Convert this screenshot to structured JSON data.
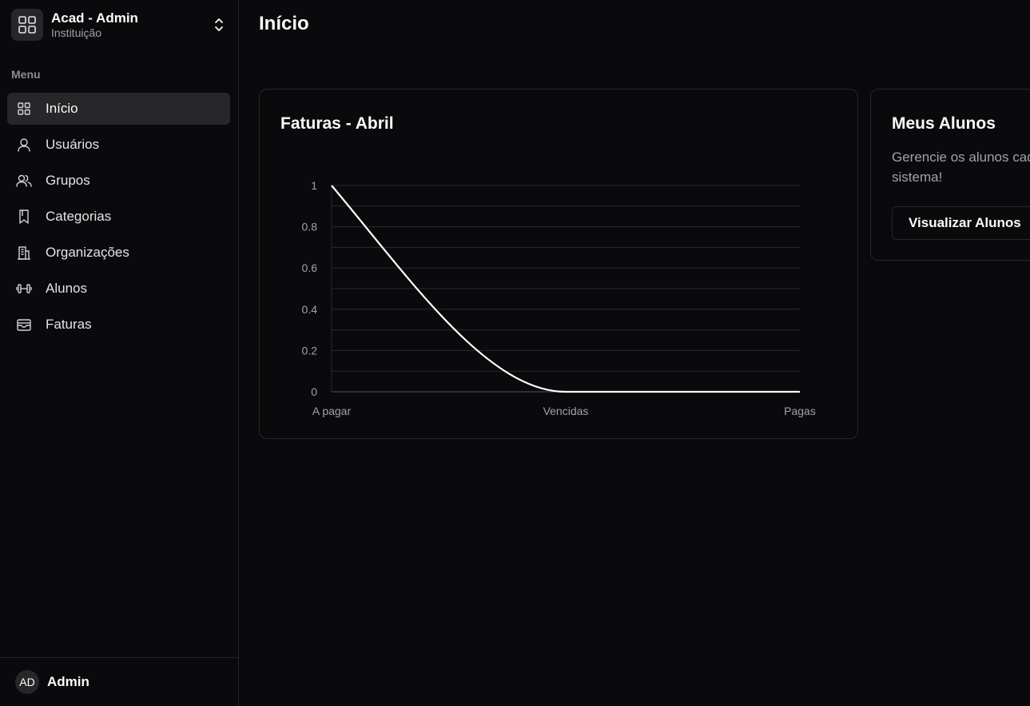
{
  "sidebar": {
    "team_name": "Acad - Admin",
    "team_subtitle": "Instituição",
    "menu_label": "Menu",
    "items": [
      {
        "label": "Início",
        "icon": "grid-icon",
        "active": true
      },
      {
        "label": "Usuários",
        "icon": "user-icon"
      },
      {
        "label": "Grupos",
        "icon": "users-icon"
      },
      {
        "label": "Categorias",
        "icon": "bookmark-icon"
      },
      {
        "label": "Organizações",
        "icon": "building-icon"
      },
      {
        "label": "Alunos",
        "icon": "dumbbell-icon"
      },
      {
        "label": "Faturas",
        "icon": "wallet-icon"
      }
    ],
    "user": {
      "initials": "AD",
      "name": "Admin"
    }
  },
  "header": {
    "title": "Início"
  },
  "chart_card": {
    "title": "Faturas - Abril"
  },
  "alunos_card": {
    "title": "Meus Alunos",
    "description_line1": "Gerencie os alunos cad",
    "description_line2": "sistema!",
    "button_label": "Visualizar Alunos"
  },
  "colors": {
    "background": "#0a0a0c",
    "card_border": "#27272a",
    "accent": "#ffffff",
    "muted": "#a1a1aa"
  },
  "chart_data": {
    "type": "line",
    "title": "Faturas - Abril",
    "categories": [
      "A pagar",
      "Vencidas",
      "Pagas"
    ],
    "values": [
      1,
      0,
      0
    ],
    "ylim": [
      0,
      1
    ],
    "yticks": [
      "0",
      "0.2",
      "0.4",
      "0.6",
      "0.8",
      "1"
    ],
    "grid": true,
    "legend": "none"
  }
}
